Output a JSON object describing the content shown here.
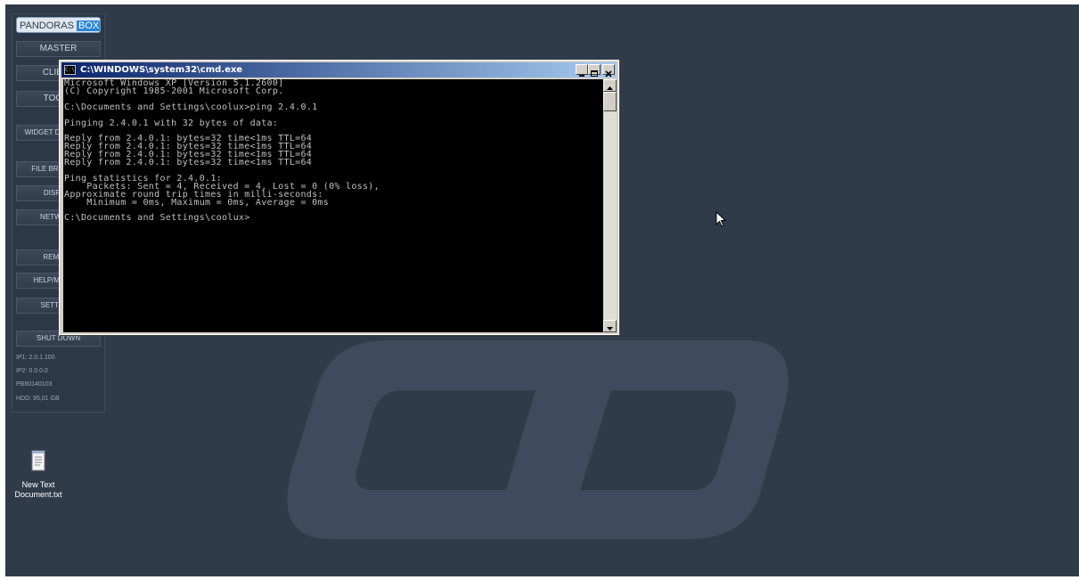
{
  "pandoras_box": {
    "logo_text": "PANDORAS",
    "logo_box": "BOX",
    "buttons": {
      "master": "MASTER",
      "client": "CLIENT",
      "tools": "TOOLS",
      "widget_designer": "WIDGET DESIGNER",
      "file_browser": "FILE BROWSER",
      "display": "DISPLAY",
      "network": "NETWORK",
      "remote": "REMOTE",
      "help": "HELP/MANUAL",
      "settings": "SETTINGS",
      "shutdown": "SHUT DOWN"
    },
    "info": {
      "ip1": "IP1: 2.0.1.100",
      "ip2": "IP2: 0.0.0.0",
      "serial": "PB80140103",
      "hdd": "HDD: 95,01 GB"
    }
  },
  "desktop_icon": {
    "label_line1": "New Text",
    "label_line2": "Document.txt",
    "icon": "text-file-icon"
  },
  "cmd": {
    "title": "C:\\WINDOWS\\system32\\cmd.exe",
    "icon": "cmd-icon",
    "output": "Microsoft Windows XP [Version 5.1.2600]\n(C) Copyright 1985-2001 Microsoft Corp.\n\nC:\\Documents and Settings\\coolux>ping 2.4.0.1\n\nPinging 2.4.0.1 with 32 bytes of data:\n\nReply from 2.4.0.1: bytes=32 time<1ms TTL=64\nReply from 2.4.0.1: bytes=32 time<1ms TTL=64\nReply from 2.4.0.1: bytes=32 time<1ms TTL=64\nReply from 2.4.0.1: bytes=32 time<1ms TTL=64\n\nPing statistics for 2.4.0.1:\n    Packets: Sent = 4, Received = 4, Lost = 0 (0% loss),\nApproximate round trip times in milli-seconds:\n    Minimum = 0ms, Maximum = 0ms, Average = 0ms\n\nC:\\Documents and Settings\\coolux>"
  },
  "colors": {
    "desktop": "#303b4a",
    "logo_watermark": "#3f4b5c",
    "console_bg": "#000000",
    "console_text": "#c0c0c0",
    "title_gradient_start": "#0a246a",
    "title_gradient_end": "#a6caf0"
  }
}
